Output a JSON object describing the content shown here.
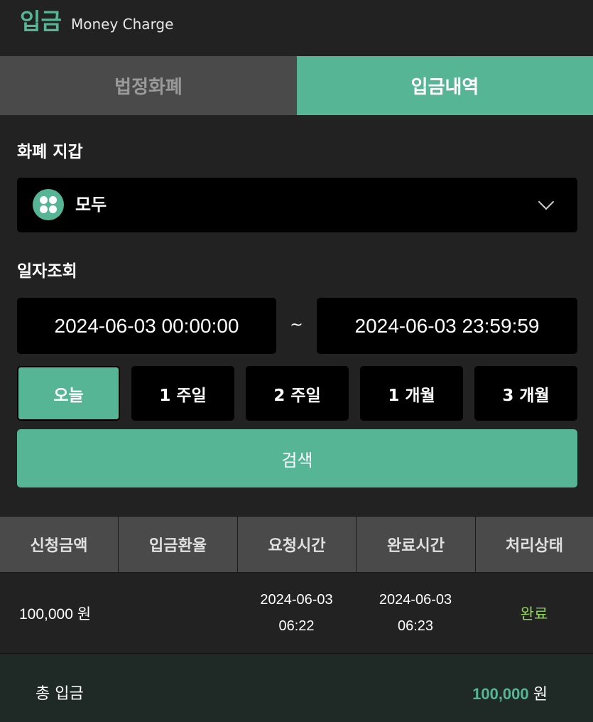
{
  "header": {
    "title": "입금",
    "subtitle": "Money Charge"
  },
  "tabs": [
    {
      "label": "법정화폐",
      "active": false
    },
    {
      "label": "입금내역",
      "active": true
    }
  ],
  "wallet": {
    "label": "화폐 지갑",
    "selected": "모두",
    "icon": "grid-icon"
  },
  "date_query": {
    "label": "일자조회",
    "start": "2024-06-03 00:00:00",
    "separator": "~",
    "end": "2024-06-03 23:59:59"
  },
  "periods": [
    {
      "label": "오늘",
      "active": true
    },
    {
      "label": "1 주일",
      "active": false
    },
    {
      "label": "2 주일",
      "active": false
    },
    {
      "label": "1 개월",
      "active": false
    },
    {
      "label": "3 개월",
      "active": false
    }
  ],
  "search_label": "검색",
  "table": {
    "headers": [
      "신청금액",
      "입금환율",
      "요청시간",
      "완료시간",
      "처리상태"
    ],
    "rows": [
      {
        "amount": "100,000 원",
        "rate": "",
        "request_date": "2024-06-03",
        "request_time": "06:22",
        "complete_date": "2024-06-03",
        "complete_time": "06:23",
        "status": "완료"
      }
    ]
  },
  "total": {
    "label": "총 입금",
    "amount": "100,000",
    "unit": " 원"
  },
  "colors": {
    "accent": "#56b594",
    "background": "#222222",
    "status_complete": "#8fd55a"
  }
}
